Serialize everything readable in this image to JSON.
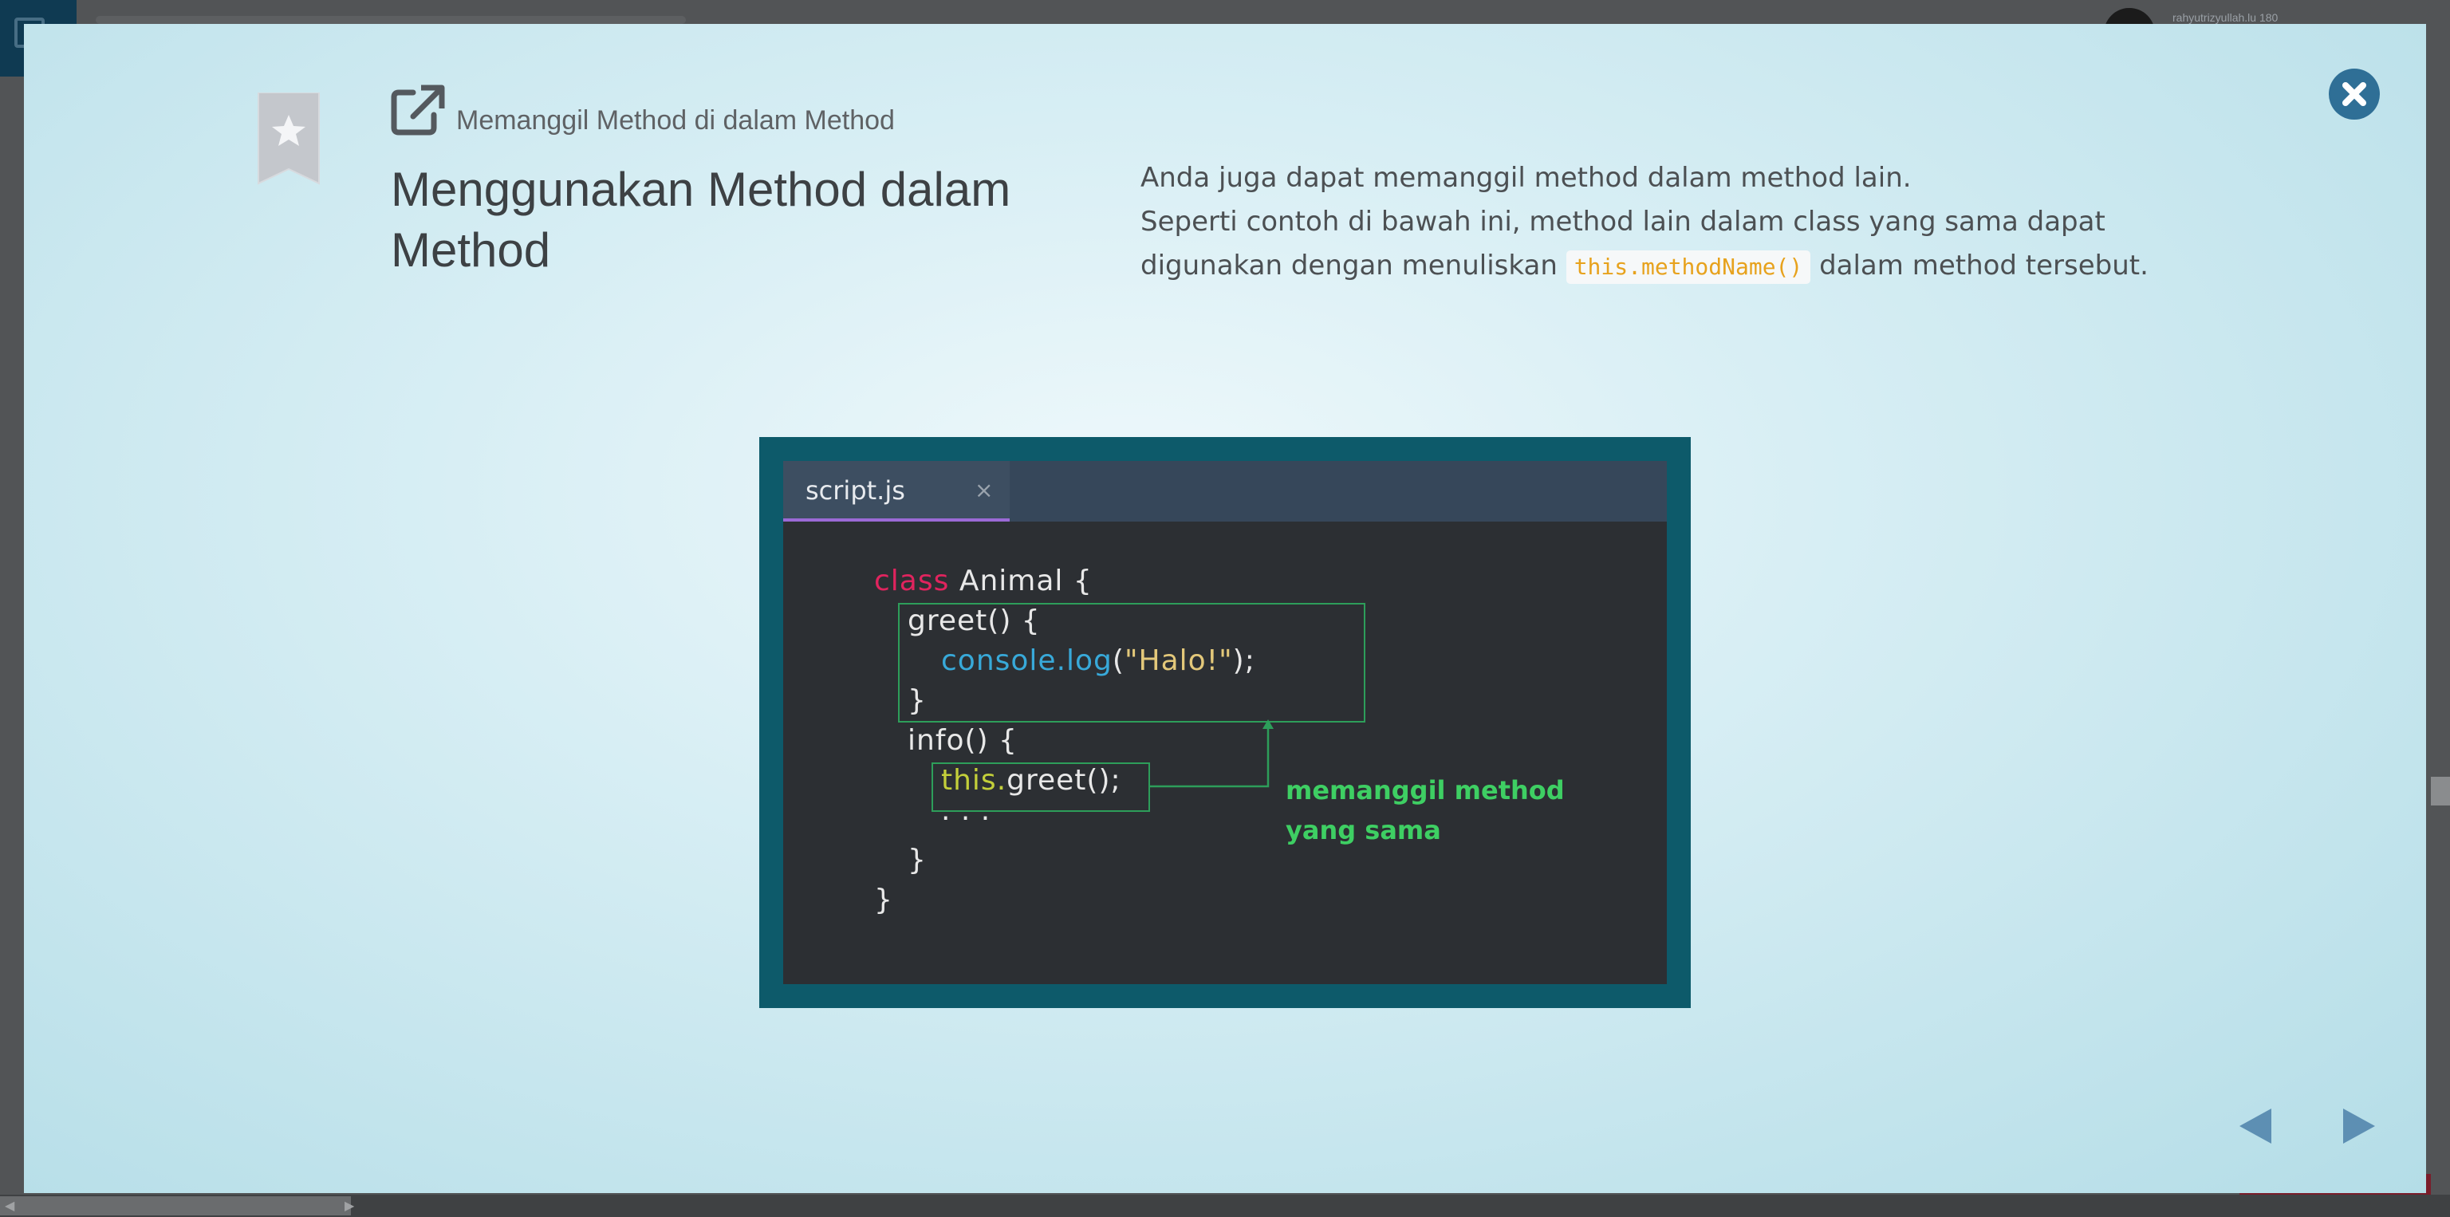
{
  "background": {
    "username": "rahyutrizyullah.lu 180"
  },
  "lesson": {
    "subtitle": "Memanggil Method di dalam Method",
    "title": "Menggunakan Method dalam Method",
    "description": {
      "line1": "Anda juga dapat memanggil method dalam method lain.",
      "line2_before": "Seperti contoh di bawah ini, method lain dalam class yang sama dapat digunakan dengan menuliskan ",
      "code": "this.methodName()",
      "line2_after": " dalam method tersebut."
    }
  },
  "figure": {
    "tab_name": "script.js",
    "tab_close": "×",
    "code_lines": [
      {
        "kw": "class",
        "rest": " Animal {"
      },
      {
        "text": "greet() {"
      },
      {
        "fn": "console.log",
        "rest_before": "(",
        "str": "\"Halo!\"",
        "rest_after": ");"
      },
      {
        "text": "}"
      },
      {
        "text": "info() {"
      },
      {
        "this": "this.",
        "rest": "greet();"
      },
      {
        "text": ". . ."
      },
      {
        "text": "}"
      },
      {
        "text": "}"
      }
    ],
    "annotation_line1": "memanggil method",
    "annotation_line2": "yang sama"
  },
  "icons": {
    "bookmark": "bookmark-star-icon",
    "share": "external-link-icon",
    "close": "close-icon",
    "prev": "triangle-left-icon",
    "next": "triangle-right-icon"
  },
  "colors": {
    "accent": "#2f6f96",
    "code_chip": "#e7a21d",
    "annotation": "#3ecf63",
    "keyword": "#e0245e"
  }
}
